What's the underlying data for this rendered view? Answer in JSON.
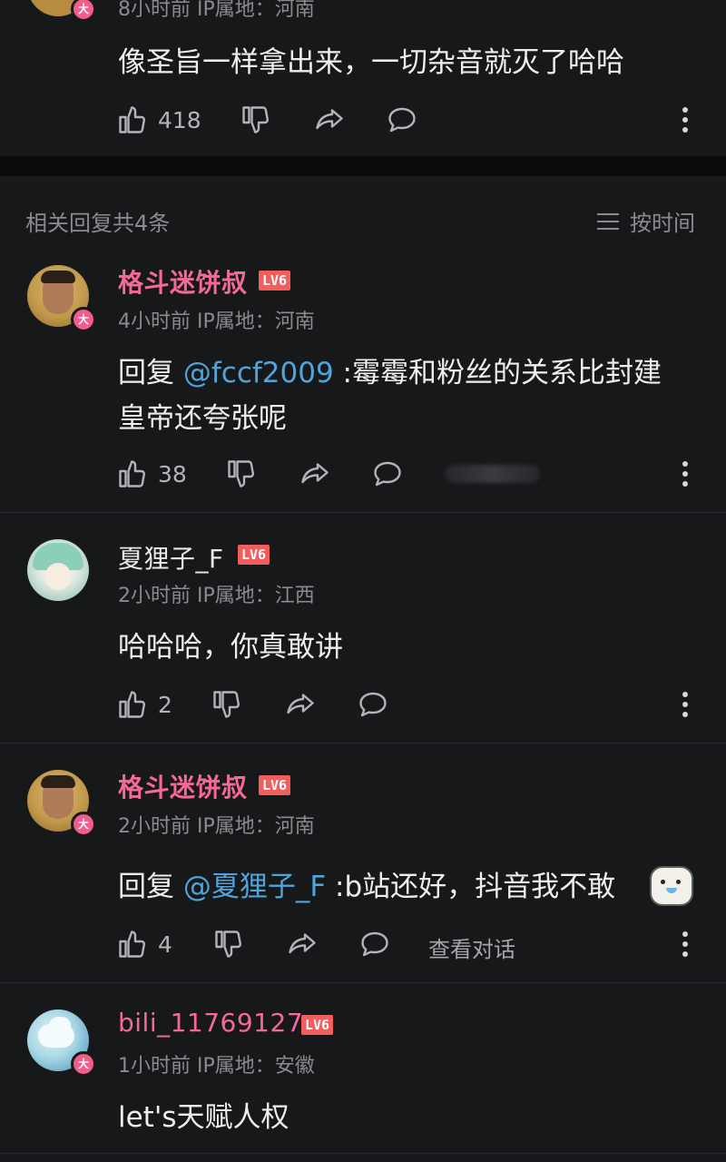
{
  "top_comment": {
    "meta": "8小时前  IP属地：河南",
    "text": "像圣旨一样拿出来，一切杂音就灭了哈哈",
    "like_count": "418"
  },
  "section": {
    "title": "相关回复共4条",
    "sort_label": "按时间"
  },
  "replies": [
    {
      "user": "格斗迷饼叔",
      "level": "LV6",
      "meta": "4小时前  IP属地：河南",
      "prefix": "回复 ",
      "mention": "@fccf2009",
      "text_line1": " :霉霉和粉丝的关系比封建",
      "text_line2": "皇帝还夸张呢",
      "likes": "38"
    },
    {
      "user": "夏狸子_F",
      "level": "LV6",
      "meta": "2小时前  IP属地：江西",
      "text": "哈哈哈，你真敢讲",
      "likes": "2"
    },
    {
      "user": "格斗迷饼叔",
      "level": "LV6",
      "meta": "2小时前  IP属地：河南",
      "prefix": "回复 ",
      "mention": "@夏狸子_F",
      "text": " :b站还好，抖音我不敢",
      "likes": "4",
      "view_conversation": "查看对话"
    },
    {
      "user": "bili_11769127",
      "level": "LV6",
      "meta": "1小时前  IP属地：安徽",
      "text": "let's天赋人权"
    }
  ],
  "badge_text": "大",
  "colors": {
    "background": "#17181a",
    "username_pink": "#f5689a",
    "mention_blue": "#4fa4d9",
    "level_red": "#f25d5d"
  },
  "icons": [
    "thumbs-up-icon",
    "thumbs-down-icon",
    "share-icon",
    "comment-icon",
    "more-icon",
    "sort-icon"
  ]
}
